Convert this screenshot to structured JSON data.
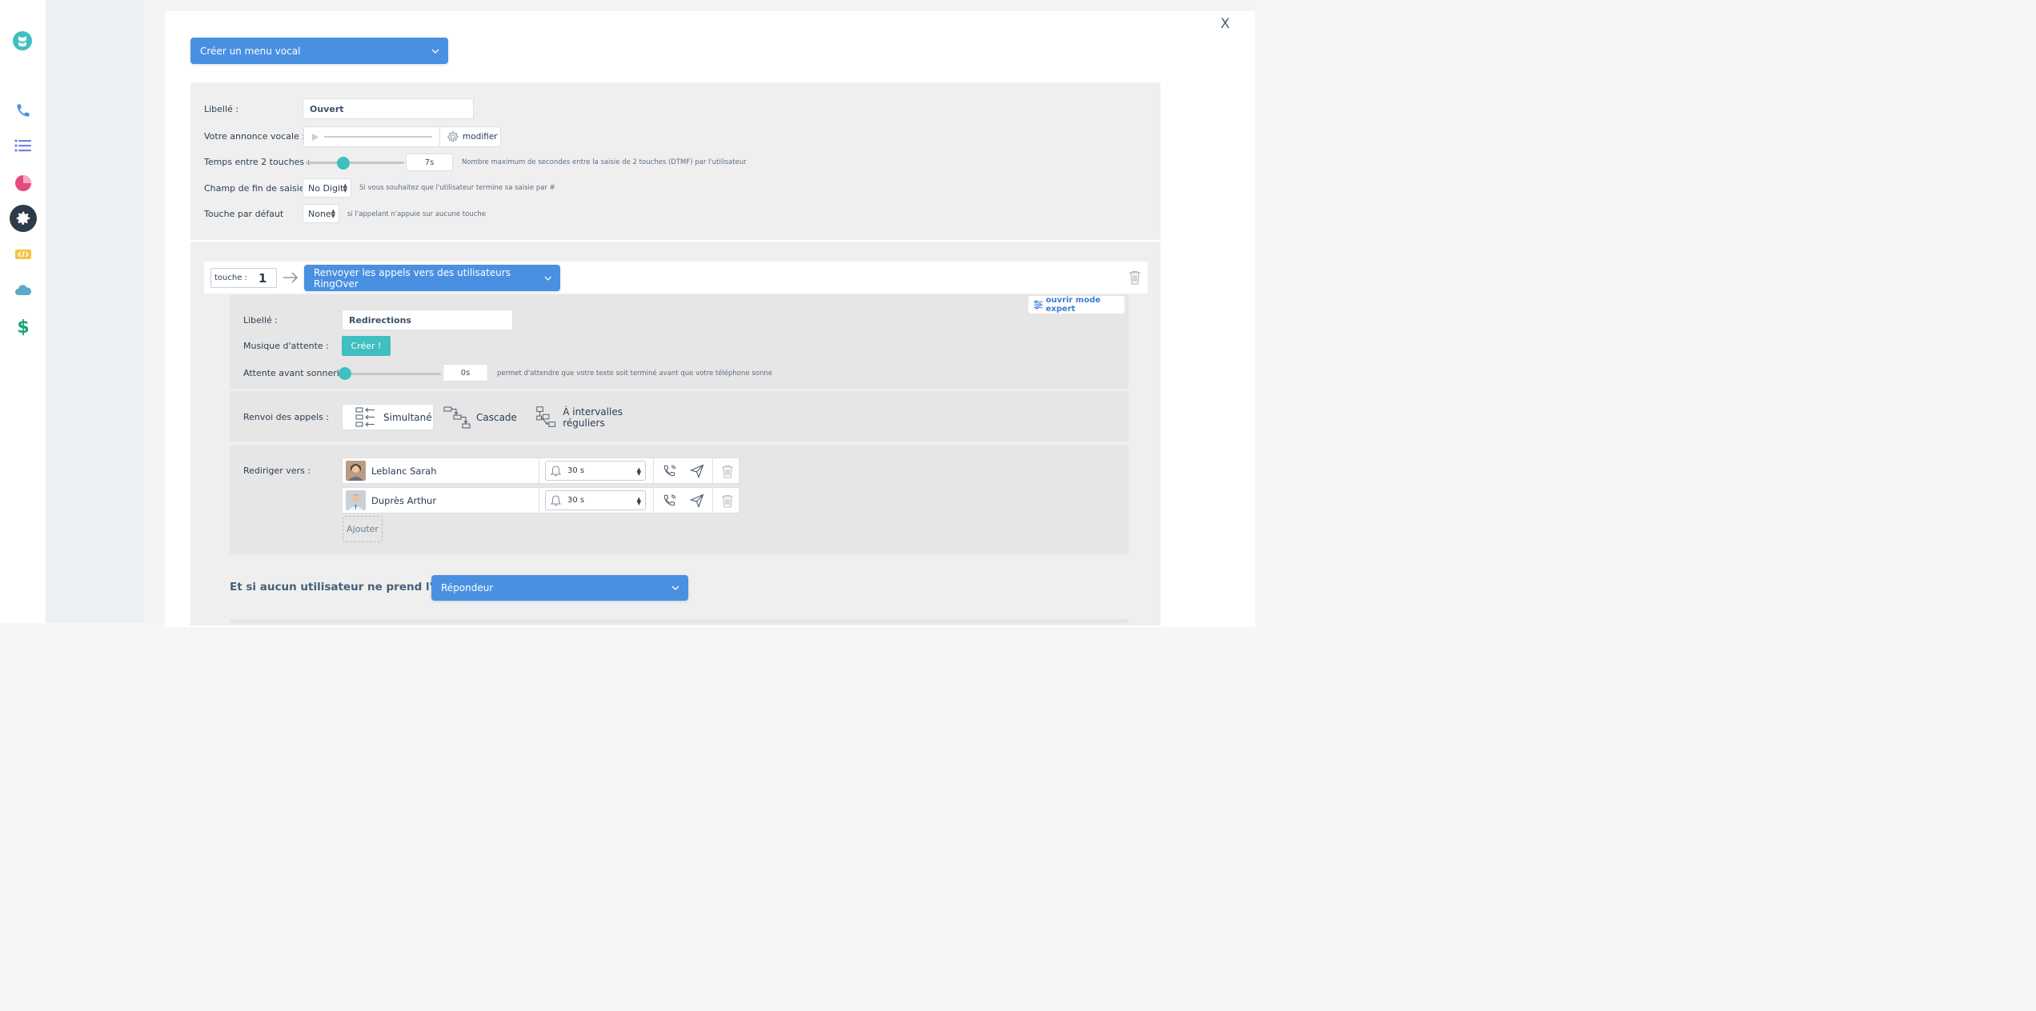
{
  "sidebar": {
    "items": [
      {
        "icon": "phone-icon",
        "color": "#4a90e2"
      },
      {
        "icon": "list-icon",
        "color": "#7b7fe8"
      },
      {
        "icon": "pie-chart-icon",
        "color": "#e84a7f"
      },
      {
        "icon": "gear-icon",
        "color": "#ffffff",
        "active": true
      },
      {
        "icon": "code-icon",
        "color": "#f5c542"
      },
      {
        "icon": "cloud-icon",
        "color": "#5aa9c9"
      },
      {
        "icon": "dollar-icon",
        "color": "#1aa37a"
      }
    ]
  },
  "modal": {
    "close": "X",
    "type_select": "Créer un menu vocal",
    "libelle_label": "Libellé :",
    "libelle_value": "Ouvert",
    "annonce_label": "Votre annonce vocale :",
    "annonce_modifier": "modifier",
    "temps_label": "Temps entre 2 touches :",
    "temps_value": "7s",
    "temps_level": 0.38,
    "temps_hint": "Nombre maximum de secondes entre la saisie de 2 touches (DTMF) par l'utilisateur",
    "fin_label": "Champ de fin de saisie",
    "fin_value": "No Digit",
    "fin_hint": "Si vous souhaitez que l'utilisateur termine sa saisie par #",
    "defaut_label": "Touche par défaut",
    "defaut_value": "None",
    "defaut_hint": "si l'appelant n'appuie sur aucune touche"
  },
  "key": {
    "label": "touche :",
    "value": "1",
    "action": "Renvoyer les appels vers des utilisateurs RingOver",
    "expert": "ouvrir mode expert",
    "libelle_label": "Libellé :",
    "libelle_value": "Redirections",
    "musique_label": "Musique d'attente :",
    "musique_button": "Créer !",
    "attente_label": "Attente avant sonnerie",
    "attente_value": "0s",
    "attente_level": 0,
    "attente_hint": "permet d'attendre que votre texte soit terminé avant que votre téléphone sonne",
    "renvoi_label": "Renvoi des appels :",
    "modes": [
      "Simultané",
      "Cascade",
      "À intervalles réguliers"
    ],
    "selected_mode": "Simultané",
    "rediriger_label": "Rediriger vers :",
    "users": [
      {
        "name": "Leblanc Sarah",
        "ring": "30 s"
      },
      {
        "name": "Duprès Arthur",
        "ring": "30 s"
      }
    ],
    "add_button": "Ajouter"
  },
  "fallback": {
    "question": "Et si aucun utilisateur ne prend l'appel ?",
    "value": "Répondeur"
  }
}
